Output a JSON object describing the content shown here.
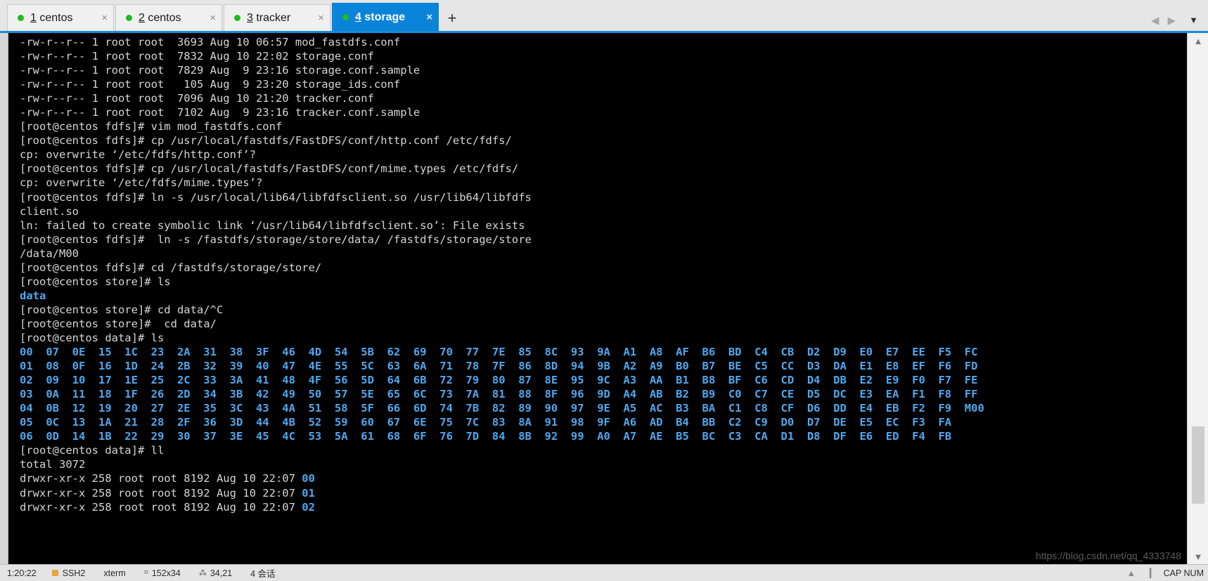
{
  "tabbar": {
    "tabs": [
      {
        "index": "1",
        "name": " centos",
        "status_color": "#1fbb1f",
        "close": "×",
        "active": false
      },
      {
        "index": "2",
        "name": " centos",
        "status_color": "#1fbb1f",
        "close": "×",
        "active": false
      },
      {
        "index": "3",
        "name": " tracker",
        "status_color": "#1fbb1f",
        "close": "×",
        "active": false
      },
      {
        "index": "4",
        "name": " storage",
        "status_color": "#1fbb1f",
        "close": "×",
        "active": true
      }
    ],
    "new_tab_label": "+",
    "nav_prev": "◀",
    "nav_next": "▶",
    "menu_caret": "▼"
  },
  "terminal": {
    "prompt_fdfs": "[root@centos fdfs]#",
    "prompt_store": "[root@centos store]#",
    "prompt_data": "[root@centos data]#",
    "file_listing": [
      "-rw-r--r-- 1 root root  3693 Aug 10 06:57 mod_fastdfs.conf",
      "-rw-r--r-- 1 root root  7832 Aug 10 22:02 storage.conf",
      "-rw-r--r-- 1 root root  7829 Aug  9 23:16 storage.conf.sample",
      "-rw-r--r-- 1 root root   105 Aug  9 23:20 storage_ids.conf",
      "-rw-r--r-- 1 root root  7096 Aug 10 21:20 tracker.conf",
      "-rw-r--r-- 1 root root  7102 Aug  9 23:16 tracker.conf.sample"
    ],
    "session_lines": [
      "[root@centos fdfs]# vim mod_fastdfs.conf",
      "[root@centos fdfs]# cp /usr/local/fastdfs/FastDFS/conf/http.conf /etc/fdfs/",
      "cp: overwrite ‘/etc/fdfs/http.conf’?",
      "[root@centos fdfs]# cp /usr/local/fastdfs/FastDFS/conf/mime.types /etc/fdfs/",
      "cp: overwrite ‘/etc/fdfs/mime.types’?",
      "[root@centos fdfs]# ln -s /usr/local/lib64/libfdfsclient.so /usr/lib64/libfdfs",
      "client.so",
      "ln: failed to create symbolic link ‘/usr/lib64/libfdfsclient.so’: File exists",
      "[root@centos fdfs]#  ln -s /fastdfs/storage/store/data/ /fastdfs/storage/store",
      "/data/M00",
      "[root@centos fdfs]# cd /fastdfs/storage/store/",
      "[root@centos store]# ls"
    ],
    "ls_store_result": "data",
    "session_lines_2": [
      "[root@centos store]# cd data/^C",
      "[root@centos store]#  cd data/",
      "[root@centos data]# ls"
    ],
    "hex_grid_rows": [
      [
        "00",
        "07",
        "0E",
        "15",
        "1C",
        "23",
        "2A",
        "31",
        "38",
        "3F",
        "46",
        "4D",
        "54",
        "5B",
        "62",
        "69",
        "70",
        "77",
        "7E",
        "85",
        "8C",
        "93",
        "9A",
        "A1",
        "A8",
        "AF",
        "B6",
        "BD",
        "C4",
        "CB",
        "D2",
        "D9",
        "E0",
        "E7",
        "EE",
        "F5",
        "FC"
      ],
      [
        "01",
        "08",
        "0F",
        "16",
        "1D",
        "24",
        "2B",
        "32",
        "39",
        "40",
        "47",
        "4E",
        "55",
        "5C",
        "63",
        "6A",
        "71",
        "78",
        "7F",
        "86",
        "8D",
        "94",
        "9B",
        "A2",
        "A9",
        "B0",
        "B7",
        "BE",
        "C5",
        "CC",
        "D3",
        "DA",
        "E1",
        "E8",
        "EF",
        "F6",
        "FD"
      ],
      [
        "02",
        "09",
        "10",
        "17",
        "1E",
        "25",
        "2C",
        "33",
        "3A",
        "41",
        "48",
        "4F",
        "56",
        "5D",
        "64",
        "6B",
        "72",
        "79",
        "80",
        "87",
        "8E",
        "95",
        "9C",
        "A3",
        "AA",
        "B1",
        "B8",
        "BF",
        "C6",
        "CD",
        "D4",
        "DB",
        "E2",
        "E9",
        "F0",
        "F7",
        "FE"
      ],
      [
        "03",
        "0A",
        "11",
        "18",
        "1F",
        "26",
        "2D",
        "34",
        "3B",
        "42",
        "49",
        "50",
        "57",
        "5E",
        "65",
        "6C",
        "73",
        "7A",
        "81",
        "88",
        "8F",
        "96",
        "9D",
        "A4",
        "AB",
        "B2",
        "B9",
        "C0",
        "C7",
        "CE",
        "D5",
        "DC",
        "E3",
        "EA",
        "F1",
        "F8",
        "FF"
      ],
      [
        "04",
        "0B",
        "12",
        "19",
        "20",
        "27",
        "2E",
        "35",
        "3C",
        "43",
        "4A",
        "51",
        "58",
        "5F",
        "66",
        "6D",
        "74",
        "7B",
        "82",
        "89",
        "90",
        "97",
        "9E",
        "A5",
        "AC",
        "B3",
        "BA",
        "C1",
        "C8",
        "CF",
        "D6",
        "DD",
        "E4",
        "EB",
        "F2",
        "F9",
        "M00"
      ],
      [
        "05",
        "0C",
        "13",
        "1A",
        "21",
        "28",
        "2F",
        "36",
        "3D",
        "44",
        "4B",
        "52",
        "59",
        "60",
        "67",
        "6E",
        "75",
        "7C",
        "83",
        "8A",
        "91",
        "98",
        "9F",
        "A6",
        "AD",
        "B4",
        "BB",
        "C2",
        "C9",
        "D0",
        "D7",
        "DE",
        "E5",
        "EC",
        "F3",
        "FA"
      ],
      [
        "06",
        "0D",
        "14",
        "1B",
        "22",
        "29",
        "30",
        "37",
        "3E",
        "45",
        "4C",
        "53",
        "5A",
        "61",
        "68",
        "6F",
        "76",
        "7D",
        "84",
        "8B",
        "92",
        "99",
        "A0",
        "A7",
        "AE",
        "B5",
        "BC",
        "C3",
        "CA",
        "D1",
        "D8",
        "DF",
        "E6",
        "ED",
        "F4",
        "FB"
      ]
    ],
    "ll_command": "[root@centos data]# ll",
    "ll_total": "total 3072",
    "ll_rows": [
      {
        "perms": "drwxr-xr-x 258 root root 8192 Aug 10 22:07 ",
        "name": "00"
      },
      {
        "perms": "drwxr-xr-x 258 root root 8192 Aug 10 22:07 ",
        "name": "01"
      },
      {
        "perms": "drwxr-xr-x 258 root root 8192 Aug 10 22:07 ",
        "name": "02"
      }
    ]
  },
  "watermark": {
    "text": "https://blog.csdn.net/qq_4333748"
  },
  "scrollbar": {
    "up": "▲",
    "down": "▼"
  },
  "statusbar": {
    "clock": "1:20:22",
    "session": "SSH2",
    "term": "xterm",
    "size_label": "152x34",
    "rows_label": "34,21",
    "sessions_label": "4 会话",
    "caps": "CAP NUM",
    "grid_icon": "⌗",
    "pos_icon": "⁂",
    "up_icon": "▲",
    "bar_icon": "▎"
  },
  "colors": {
    "tab_active_bg": "#0a84d8",
    "terminal_bg": "#000000",
    "terminal_fg": "#d6d6d6",
    "dir_color": "#4fa8f0",
    "status_dot": "#1fbb1f"
  }
}
